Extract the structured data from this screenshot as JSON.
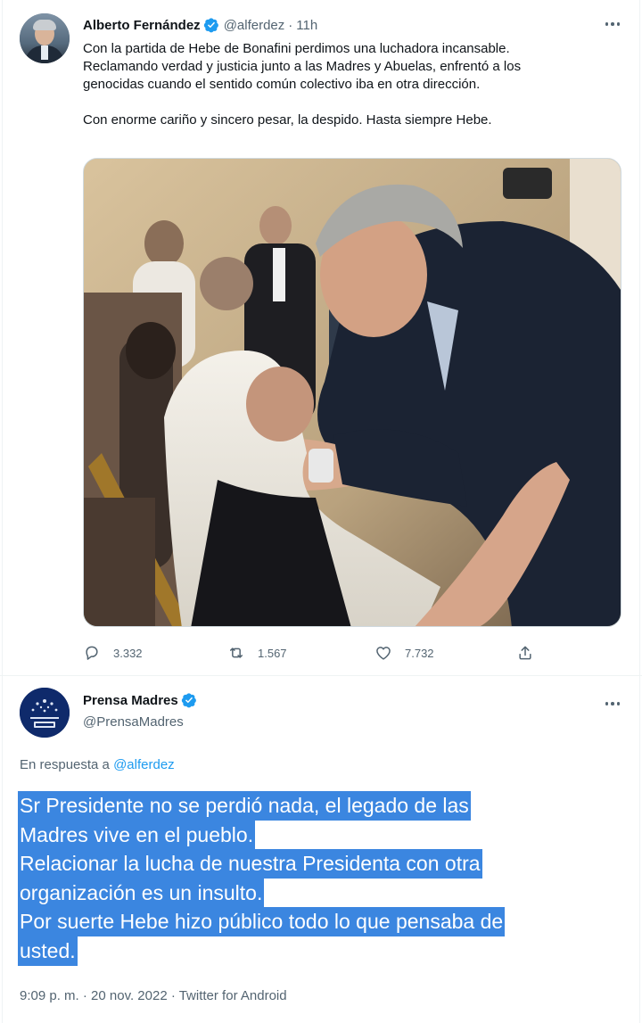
{
  "tweet1": {
    "author_name": "Alberto Fernández",
    "handle": "@alferdez",
    "separator": "·",
    "time": "11h",
    "lines": [
      "Con la partida de Hebe de Bonafini perdimos una luchadora incansable.",
      "Reclamando verdad y justicia junto a las Madres y Abuelas, enfrentó a los",
      "genocidas cuando el sentido común colectivo iba en otra dirección."
    ],
    "line_second_paragraph": "Con enorme cariño y sincero pesar, la despido. Hasta siempre Hebe.",
    "stats": {
      "replies": "3.332",
      "retweets": "1.567",
      "likes": "7.732"
    }
  },
  "tweet2": {
    "author_name": "Prensa Madres",
    "handle": "@PrensaMadres",
    "reply_prefix": "En respuesta a",
    "reply_mention": "@alferdez",
    "lines": [
      "Sr Presidente no se perdió nada, el legado de las",
      "Madres vive en el pueblo.",
      "Relacionar la lucha de nuestra Presidenta con otra",
      "organización es un insulto.",
      "Por suerte Hebe hizo público todo lo que pensaba de",
      "usted."
    ],
    "timestamp": "9:09 p. m. · 20 nov. 2022 · Twitter for Android"
  },
  "icons": {
    "verified": "verified-badge-icon",
    "more": "more-horizontal-icon",
    "reply": "reply-icon",
    "retweet": "retweet-icon",
    "like": "heart-icon",
    "share": "share-icon"
  },
  "colors": {
    "accent": "#1d9bf0",
    "highlight": "#3b86e0",
    "secondary_text": "#536471"
  }
}
